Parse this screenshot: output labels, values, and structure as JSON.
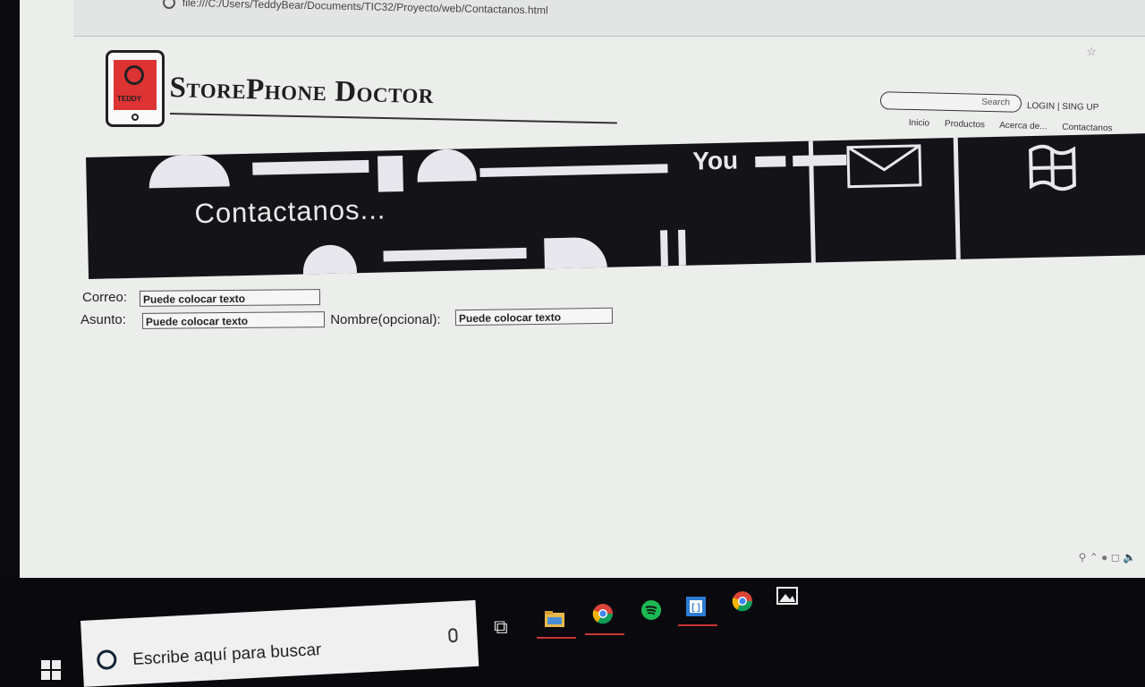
{
  "browser": {
    "url": "file:///C:/Users/TeddyBear/Documents/TIC32/Proyecto/web/Contactanos.html"
  },
  "header": {
    "site_title": "StorePhone Doctor",
    "logo_text": "TEDDY",
    "search_placeholder": "Search",
    "login_link": "LOGIN | SING UP",
    "nav": [
      "Inicio",
      "Productos",
      "Acerca de...",
      "Contactanos"
    ]
  },
  "banner": {
    "heading": "Contactanos...",
    "you_text": "You"
  },
  "form": {
    "correo_label": "Correo:",
    "correo_value": "Puede colocar texto",
    "asunto_label": "Asunto:",
    "asunto_value": "Puede colocar texto",
    "nombre_label": "Nombre(opcional):",
    "nombre_value": "Puede colocar texto"
  },
  "taskbar": {
    "search_placeholder": "Escribe aquí para buscar",
    "apps": [
      "task-view",
      "file-explorer",
      "chrome",
      "spotify",
      "brackets",
      "chrome",
      "photos"
    ]
  }
}
